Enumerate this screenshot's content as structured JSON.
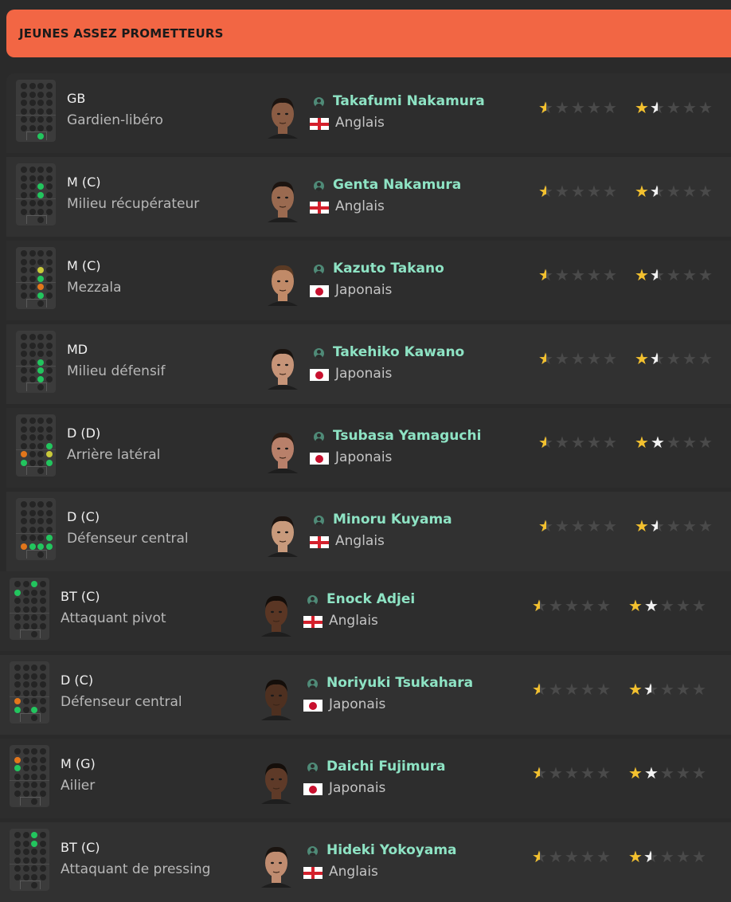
{
  "section_title": "JEUNES ASSEZ PROMETTEURS",
  "players": [
    {
      "pos": "GB",
      "role": "Gardien-libéro",
      "name": "Takafumi Nakamura",
      "nationality": "Anglais",
      "flag": "england-flag-icon",
      "ca_stars": 0.5,
      "pa_stars": 1.5,
      "pa_style": "mixed",
      "face_color": "#8a5c44",
      "hair": "#1c1410",
      "dots": [
        {
          "c": "green",
          "r": 6,
          "col": 2
        }
      ]
    },
    {
      "pos": "M (C)",
      "role": "Milieu récupérateur",
      "name": "Genta Nakamura",
      "nationality": "Anglais",
      "flag": "england-flag-icon",
      "ca_stars": 0.5,
      "pa_stars": 1.5,
      "pa_style": "mixed",
      "face_color": "#9a6a50",
      "hair": "#1c1410",
      "dots": [
        {
          "c": "green",
          "r": 2,
          "col": 2
        },
        {
          "c": "green",
          "r": 3,
          "col": 2
        }
      ]
    },
    {
      "pos": "M (C)",
      "role": "Mezzala",
      "name": "Kazuto Takano",
      "nationality": "Japonais",
      "flag": "japan-flag-icon",
      "ca_stars": 0.5,
      "pa_stars": 1.5,
      "pa_style": "mixed",
      "face_color": "#c08a68",
      "hair": "#5a3a24",
      "dots": [
        {
          "c": "yellow",
          "r": 2,
          "col": 2
        },
        {
          "c": "green",
          "r": 3,
          "col": 2
        },
        {
          "c": "orange",
          "r": 4,
          "col": 2
        },
        {
          "c": "green",
          "r": 5,
          "col": 2
        }
      ]
    },
    {
      "pos": "MD",
      "role": "Milieu défensif",
      "name": "Takehiko Kawano",
      "nationality": "Japonais",
      "flag": "japan-flag-icon",
      "ca_stars": 0.5,
      "pa_stars": 1.5,
      "pa_style": "mixed",
      "face_color": "#c69478",
      "hair": "#1a1410",
      "dots": [
        {
          "c": "green",
          "r": 3,
          "col": 2
        },
        {
          "c": "green",
          "r": 4,
          "col": 2
        },
        {
          "c": "green",
          "r": 5,
          "col": 2
        }
      ]
    },
    {
      "pos": "D (D)",
      "role": "Arrière latéral",
      "name": "Tsubasa Yamaguchi",
      "nationality": "Japonais",
      "flag": "japan-flag-icon",
      "ca_stars": 0.5,
      "pa_stars": 2,
      "pa_style": "white",
      "face_color": "#b8806a",
      "hair": "#2a1c14",
      "dots": [
        {
          "c": "green",
          "r": 3,
          "col": 3
        },
        {
          "c": "orange",
          "r": 4,
          "col": 0
        },
        {
          "c": "yellow",
          "r": 4,
          "col": 3
        },
        {
          "c": "green",
          "r": 5,
          "col": 0
        },
        {
          "c": "green",
          "r": 5,
          "col": 3
        }
      ]
    },
    {
      "pos": "D (C)",
      "role": "Défenseur central",
      "name": "Minoru Kuyama",
      "nationality": "Anglais",
      "flag": "england-flag-icon",
      "ca_stars": 0.5,
      "pa_stars": 1.5,
      "pa_style": "mixed",
      "face_color": "#c89a7c",
      "hair": "#1c1410",
      "dots": [
        {
          "c": "green",
          "r": 4,
          "col": 3
        },
        {
          "c": "orange",
          "r": 5,
          "col": 0
        },
        {
          "c": "green",
          "r": 5,
          "col": 1
        },
        {
          "c": "green",
          "r": 5,
          "col": 2
        },
        {
          "c": "green",
          "r": 5,
          "col": 3
        }
      ]
    },
    {
      "pos": "BT (C)",
      "role": "Attaquant pivot",
      "name": "Enock Adjei",
      "nationality": "Anglais",
      "flag": "england-flag-icon",
      "ca_stars": 0.5,
      "pa_stars": 2,
      "pa_style": "white",
      "face_color": "#5a3624",
      "hair": "#140e0a",
      "dots": [
        {
          "c": "green",
          "r": 0,
          "col": 2
        },
        {
          "c": "green",
          "r": 1,
          "col": 0
        }
      ]
    },
    {
      "pos": "D (C)",
      "role": "Défenseur central",
      "name": "Noriyuki Tsukahara",
      "nationality": "Japonais",
      "flag": "japan-flag-icon",
      "ca_stars": 0.5,
      "pa_stars": 1.5,
      "pa_style": "mixed",
      "face_color": "#4e3020",
      "hair": "#140e0a",
      "dots": [
        {
          "c": "orange",
          "r": 4,
          "col": 0
        },
        {
          "c": "green",
          "r": 5,
          "col": 0
        },
        {
          "c": "green",
          "r": 5,
          "col": 2
        }
      ]
    },
    {
      "pos": "M (G)",
      "role": "Ailier",
      "name": "Daichi Fujimura",
      "nationality": "Japonais",
      "flag": "japan-flag-icon",
      "ca_stars": 0.5,
      "pa_stars": 2,
      "pa_style": "white",
      "face_color": "#5e3a28",
      "hair": "#140e0a",
      "dots": [
        {
          "c": "orange",
          "r": 1,
          "col": 0
        },
        {
          "c": "green",
          "r": 2,
          "col": 0
        }
      ]
    },
    {
      "pos": "BT (C)",
      "role": "Attaquant de pressing",
      "name": "Hideki Yokoyama",
      "nationality": "Anglais",
      "flag": "england-flag-icon",
      "ca_stars": 0.5,
      "pa_stars": 1.5,
      "pa_style": "mixed",
      "face_color": "#c08c70",
      "hair": "#1a1410",
      "dots": [
        {
          "c": "green",
          "r": 0,
          "col": 2
        },
        {
          "c": "green",
          "r": 1,
          "col": 2
        }
      ]
    }
  ],
  "dot_colors": {
    "green": "#22c55e",
    "orange": "#e2761b",
    "yellow": "#c9c93a"
  }
}
